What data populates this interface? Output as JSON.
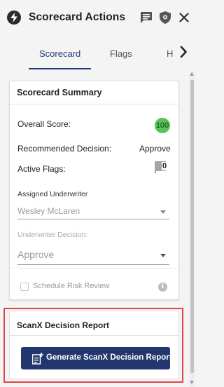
{
  "header": {
    "title": "Scorecard Actions",
    "icons": [
      "lightning-bolt-icon",
      "comment-icon",
      "shield-icon",
      "close-icon"
    ]
  },
  "tabs": [
    {
      "label": "Scorecard",
      "active": true
    },
    {
      "label": "Flags",
      "active": false
    },
    {
      "label": "H",
      "active": false
    }
  ],
  "summary": {
    "title": "Scorecard Summary",
    "overall_score_label": "Overall Score:",
    "overall_score_value": "100",
    "recommended_decision_label": "Recommended Decision:",
    "recommended_decision_value": "Approve",
    "active_flags_label": "Active Flags:",
    "active_flags_value": "0",
    "assigned_underwriter_label": "Assigned Underwriter",
    "assigned_underwriter_value": "Wesley McLaren",
    "underwriter_decision_label": "Underwriter Decision:",
    "underwriter_decision_value": "Approve",
    "schedule_risk_review_label": "Schedule Risk Review",
    "schedule_risk_review_checked": false
  },
  "scanx": {
    "title": "ScanX Decision Report",
    "button_label": "Generate ScanX Decision Report"
  },
  "colors": {
    "primary_navy": "#23366e",
    "score_green": "#55c455",
    "highlight_red": "#e0454a"
  }
}
